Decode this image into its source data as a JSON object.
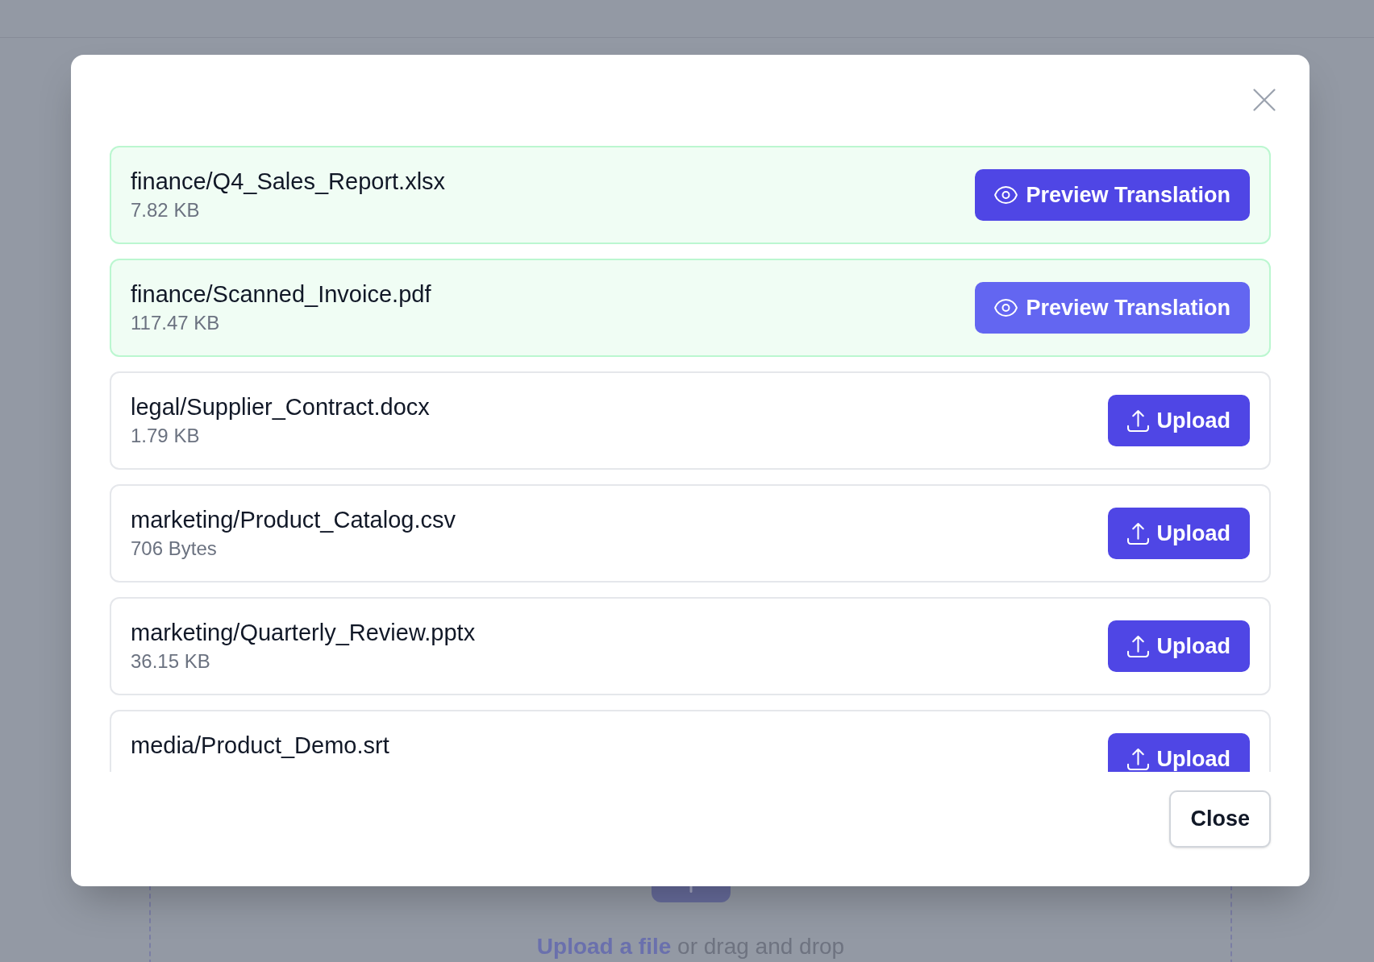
{
  "dialog": {
    "files": [
      {
        "name": "finance/Q4_Sales_Report.xlsx",
        "size": "7.82 KB",
        "translated": true,
        "action": {
          "kind": "preview",
          "label": "Preview Translation",
          "hovered": false
        }
      },
      {
        "name": "finance/Scanned_Invoice.pdf",
        "size": "117.47 KB",
        "translated": true,
        "action": {
          "kind": "preview",
          "label": "Preview Translation",
          "hovered": true
        }
      },
      {
        "name": "legal/Supplier_Contract.docx",
        "size": "1.79 KB",
        "translated": false,
        "action": {
          "kind": "upload",
          "label": "Upload",
          "hovered": false
        }
      },
      {
        "name": "marketing/Product_Catalog.csv",
        "size": "706 Bytes",
        "translated": false,
        "action": {
          "kind": "upload",
          "label": "Upload",
          "hovered": false
        }
      },
      {
        "name": "marketing/Quarterly_Review.pptx",
        "size": "36.15 KB",
        "translated": false,
        "action": {
          "kind": "upload",
          "label": "Upload",
          "hovered": false
        }
      },
      {
        "name": "media/Product_Demo.srt",
        "translated": false,
        "action": {
          "kind": "upload",
          "label": "Upload",
          "hovered": false
        }
      }
    ],
    "close_button": "Close"
  },
  "dropzone": {
    "link": "Upload a file",
    "hint": "or drag and drop"
  }
}
